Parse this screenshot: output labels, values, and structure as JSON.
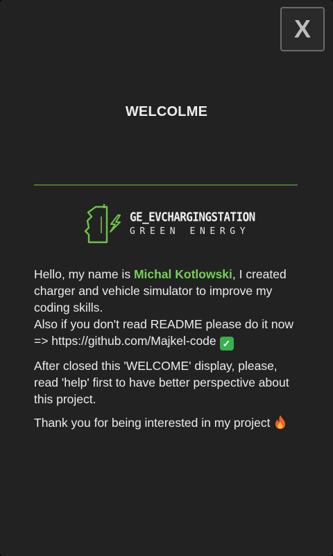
{
  "dialog": {
    "close_label": "X",
    "title": "WELCOLME"
  },
  "logo": {
    "name": "GE_EVCHARGINGSTATION",
    "tagline": "GREEN ENERGY",
    "icon": "ev-charger-logo-icon"
  },
  "content": {
    "p1_hello": "Hello, my name is ",
    "p1_name": "Michal Kotlowski",
    "p1_rest": ", I created charger and vehicle simulator to improve my coding skills.",
    "p1_readme": "Also if you don't read README please do it now",
    "p1_link": "=> https://github.com/Majkel-code",
    "p2": "After closed this 'WELCOME' display, please, read 'help' first to have better perspective about this project.",
    "p3": "Thank you for being interested in my project"
  },
  "icons": {
    "check": "check-mark-emoji-icon",
    "fire": "fire-emoji-icon"
  },
  "colors": {
    "background": "#222222",
    "accent": "#74d155",
    "divider": "#6fc34a",
    "text": "#ececec"
  }
}
